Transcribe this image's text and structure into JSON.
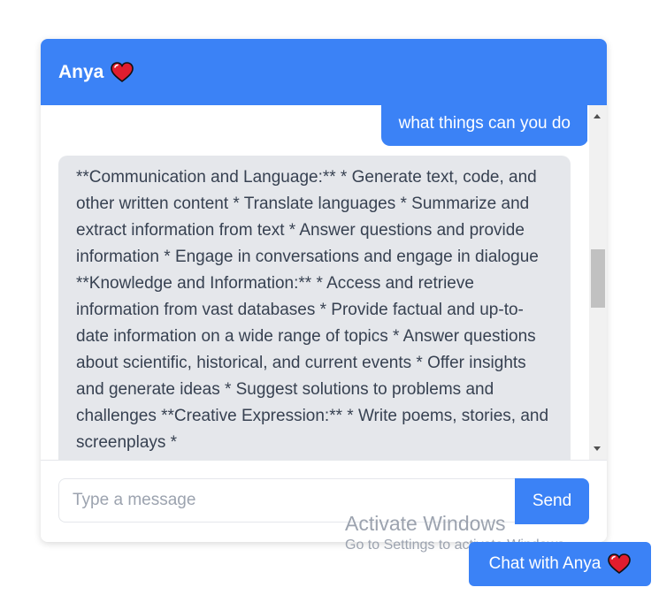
{
  "colors": {
    "accent": "#3b82f6",
    "bot_bubble": "#e5e7eb",
    "heart": "#e11d2e"
  },
  "header": {
    "title": "Anya",
    "icon": "heart-icon"
  },
  "messages": [
    {
      "role": "user",
      "text": "what things can you do"
    },
    {
      "role": "bot",
      "text": "**Communication and Language:** * Generate text, code, and other written content * Translate languages * Summarize and extract information from text * Answer questions and provide information * Engage in conversations and engage in dialogue **Knowledge and Information:** * Access and retrieve information from vast databases * Provide factual and up-to-date information on a wide range of topics * Answer questions about scientific, historical, and current events * Offer insights and generate ideas * Suggest solutions to problems and challenges **Creative Expression:** * Write poems, stories, and screenplays *"
    }
  ],
  "input": {
    "placeholder": "Type a message",
    "value": "",
    "send_label": "Send"
  },
  "launcher": {
    "label": "Chat with Anya",
    "icon": "heart-icon"
  },
  "watermark": {
    "title": "Activate Windows",
    "subtitle": "Go to Settings to activate Windows."
  }
}
